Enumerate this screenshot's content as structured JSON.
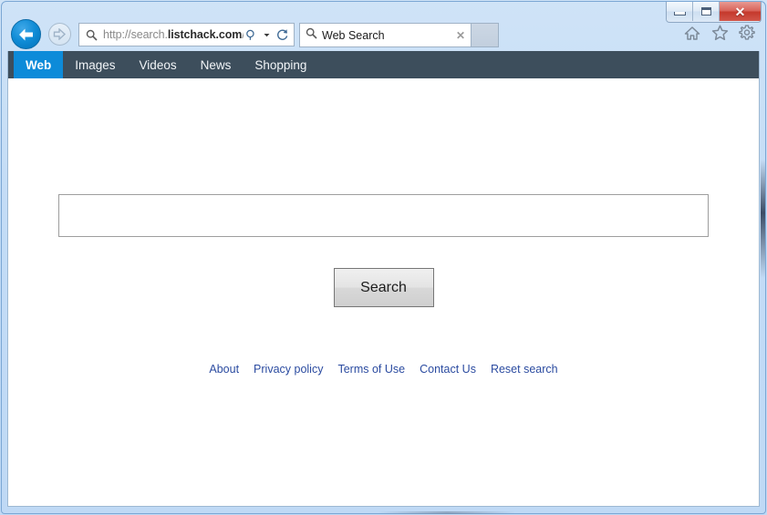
{
  "window": {
    "caption_buttons": [
      {
        "name": "minimize",
        "glyph": "minimize-icon"
      },
      {
        "name": "maximize",
        "glyph": "maximize-icon"
      },
      {
        "name": "close",
        "glyph": "✕"
      }
    ]
  },
  "browser": {
    "back_button_label": "Back",
    "forward_button_label": "Forward",
    "address": {
      "url_prefix": "http://search.",
      "url_domain": "listchack.com",
      "url_suffix": "/",
      "full_url": "http://search.listchack.com/",
      "search_icon": "magnifier-icon",
      "dropdown_icon": "chevron-down-icon",
      "refresh_icon": "refresh-icon"
    },
    "tabs": [
      {
        "label": "Web Search",
        "icon": "magnifier-icon",
        "close_label": "✕",
        "active": true
      }
    ],
    "new_tab_label": "",
    "tools": [
      {
        "name": "home-icon",
        "label": "Home"
      },
      {
        "name": "favorites-star-icon",
        "label": "Favorites"
      },
      {
        "name": "gear-icon",
        "label": "Tools"
      }
    ]
  },
  "site": {
    "nav": [
      {
        "label": "Web",
        "active": true
      },
      {
        "label": "Images",
        "active": false
      },
      {
        "label": "Videos",
        "active": false
      },
      {
        "label": "News",
        "active": false
      },
      {
        "label": "Shopping",
        "active": false
      }
    ],
    "search": {
      "value": "",
      "placeholder": "",
      "button_label": "Search"
    },
    "footer_links": [
      "About",
      "Privacy policy",
      "Terms of Use",
      "Contact Us",
      "Reset search"
    ]
  },
  "colors": {
    "nav_background": "#3d4e5c",
    "nav_active": "#0d8bd9",
    "link": "#2b4ba0",
    "frame": "#c3dcf6",
    "close_button": "#c4392c"
  }
}
